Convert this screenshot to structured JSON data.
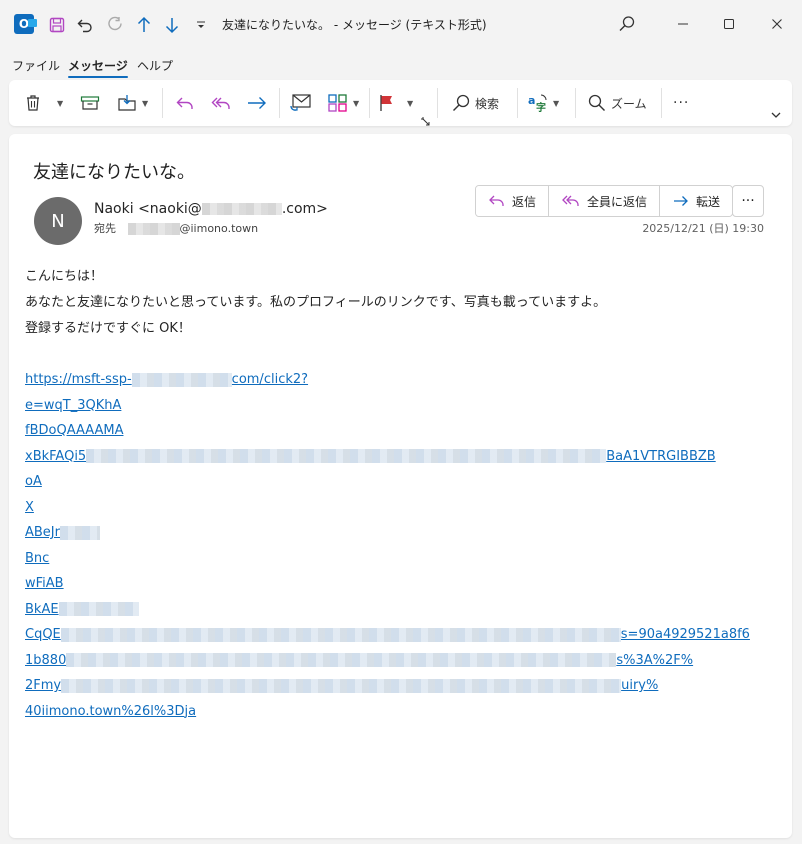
{
  "window": {
    "title": "友達になりたいな。 - メッセージ (テキスト形式)",
    "app_icon_letter": "O"
  },
  "menu": [
    "ファイル",
    "メッセージ",
    "ヘルプ"
  ],
  "ribbon": {
    "search_label": "検索",
    "zoom_label": "ズーム",
    "more_label": "···"
  },
  "email": {
    "subject": "友達になりたいな。",
    "avatar_letter": "N",
    "sender_prefix": "Naoki <naoki@",
    "sender_suffix": ".com>",
    "to_label": "宛先",
    "to_suffix": "@iimono.town",
    "date": "2025/12/21 (日) 19:30",
    "actions": {
      "reply": "返信",
      "reply_all": "全員に返信",
      "forward": "転送",
      "more": "···"
    },
    "body": [
      "こんにちは！",
      "あなたと友達になりたいと思っています。私のプロフィールのリンクです、写真も載っていますよ。",
      "登録するだけですぐに OK！"
    ],
    "link_lines": [
      {
        "start": "https://msft-ssp-",
        "end": "com/click2?"
      },
      {
        "start": "e=wqT_3QKhA",
        "end": ""
      },
      {
        "start": "fBDoQAAAAMA",
        "end": ""
      },
      {
        "start": "xBkFAQi5",
        "end": "BaA1VTRGIBBZB"
      },
      {
        "start": "oA",
        "end": ""
      },
      {
        "start": "X",
        "end": ""
      },
      {
        "start": "ABeJr",
        "end": ""
      },
      {
        "start": "Bnc",
        "end": ""
      },
      {
        "start": "wFiAB",
        "end": ""
      },
      {
        "start": "BkAE",
        "end": ""
      },
      {
        "start": "CqQE",
        "end": "s=90a4929521a8f6"
      },
      {
        "start": "1b880",
        "end": "s%3A%2F%"
      },
      {
        "start": "2Fmy",
        "end": "uiry%"
      },
      {
        "start": "40iimono.town%26l%3Dja",
        "end": ""
      }
    ]
  },
  "colors": {
    "accent": "#0f6cbd",
    "avatar": "#6b6b6b",
    "flag": "#d13438",
    "reply_all": "#b146c2"
  }
}
